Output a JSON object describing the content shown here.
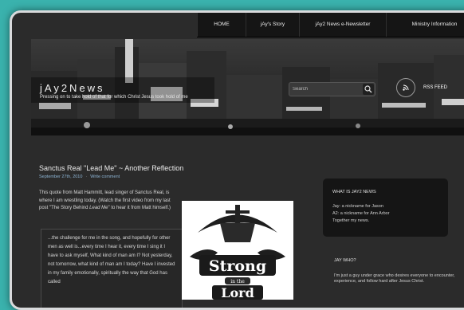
{
  "nav": {
    "items": [
      "HOME",
      "jAy's Story",
      "jAy2 News e-Newsletter",
      "Ministry Information"
    ]
  },
  "header": {
    "title": "jAy2News",
    "tagline": "Pressing on to take hold of that for which Christ Jesus took hold of me",
    "search_placeholder": "Search",
    "rss_label": "RSS FEED",
    "rss_icon": "rss-icon",
    "search_icon": "magnifier-icon"
  },
  "post": {
    "title": "Sanctus Real \"Lead Me\" ~ Another Reflection",
    "date": "September 27th, 2010",
    "comment_link": "Write comment",
    "intro_before": "This quote from Matt Hammitt, lead singer of Sanctus Real, is where I am wrestling today.  (Watch the first video from my last post \"The Story Behind ",
    "intro_italic": "Lead Me",
    "intro_after": "\" to hear it from Matt himself.)",
    "quote": "...the challenge for me in the song, and hopefully for other men as well is...every time I hear it, every time I sing it I have to ask myself, What kind of man am I? Not yesterday, not tomorrow, what kind of man am I today? Have I invested in my family emotionally, spiritually the way that God has called",
    "image": {
      "line1": "Strong",
      "line2": "in the",
      "line3": "Lord"
    }
  },
  "sidebar": {
    "box_title": "WHAT IS JAY2 NEWS",
    "box_lines": [
      "Jay: a nickname for Jason",
      "A2: a nickname for Ann Arbor",
      "Together my news."
    ],
    "jay_title": "JAY WHO?",
    "jay_text": "I'm just a guy under grace who desires everyone to encounter, experience, and follow hard after Jesus Christ."
  },
  "colors": {
    "page_background": "#3ab2ad",
    "link": "#8eb6d6",
    "frame_border": "#d9dadc"
  }
}
